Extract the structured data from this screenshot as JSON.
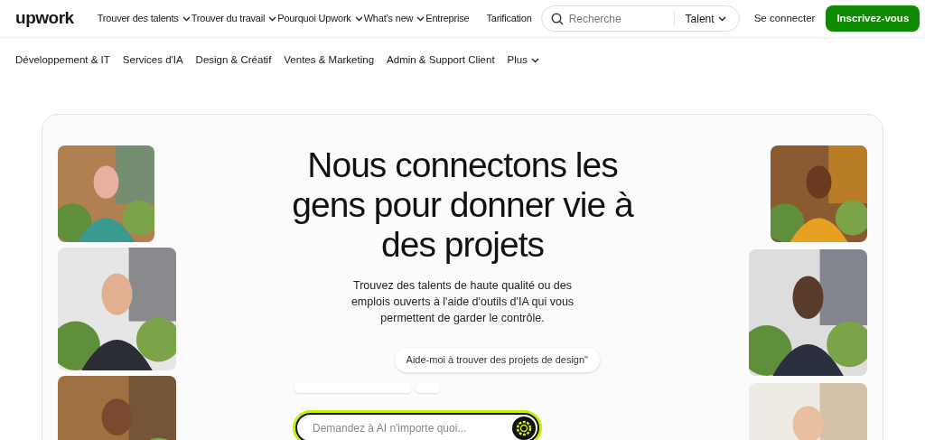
{
  "header": {
    "logo": "upwork",
    "nav": [
      {
        "label": "Trouver des talents",
        "dropdown": true
      },
      {
        "label": "Trouver du travail",
        "dropdown": true
      },
      {
        "label": "Pourquoi Upwork",
        "dropdown": true
      },
      {
        "label": "What’s new",
        "dropdown": true
      },
      {
        "label": "Entreprise",
        "dropdown": false
      },
      {
        "label": "Tarification",
        "dropdown": false
      }
    ],
    "search": {
      "placeholder": "Recherche",
      "scope": "Talent"
    },
    "login": "Se connecter",
    "signup": "Inscrivez-vous"
  },
  "categories": [
    {
      "label": "Développement & IT",
      "dropdown": false
    },
    {
      "label": "Services d'IA",
      "dropdown": false
    },
    {
      "label": "Design & Créatif",
      "dropdown": false
    },
    {
      "label": "Ventes & Marketing",
      "dropdown": false
    },
    {
      "label": "Admin & Support Client",
      "dropdown": false
    },
    {
      "label": "Plus",
      "dropdown": true
    }
  ],
  "hero": {
    "title": "Nous connectons les gens pour donner vie à des projets",
    "subtitle": "Trouvez des talents de haute qualité ou des emplois ouverts à l'aide d'outils d'IA qui vous permettent de garder le contrôle.",
    "suggestion": "Aide-moi à trouver des projets de design\"",
    "ai_input": {
      "placeholder": "Demandez à AI n'importe quoi..."
    }
  }
}
